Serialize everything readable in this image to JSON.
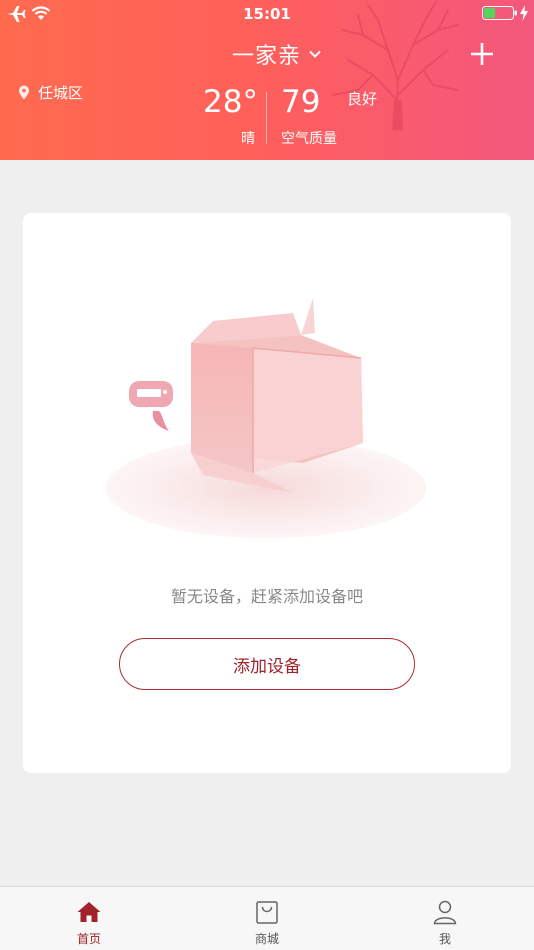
{
  "status_bar": {
    "time": "15:01",
    "battery_percent": 40
  },
  "header": {
    "family_name": "一家亲",
    "location": "任城区",
    "temperature": "28°",
    "weather": "晴",
    "aqi_value": "79",
    "aqi_level": "良好",
    "aqi_label": "空气质量"
  },
  "main": {
    "empty_message": "暂无设备，赶紧添加设备吧",
    "add_button_label": "添加设备"
  },
  "tabbar": {
    "tabs": [
      {
        "label": "首页",
        "icon": "home-icon",
        "active": true
      },
      {
        "label": "商城",
        "icon": "shopping-bag-icon",
        "active": false
      },
      {
        "label": "我",
        "icon": "user-icon",
        "active": false
      }
    ]
  },
  "colors": {
    "header_gradient_start": "#ff6a4f",
    "header_gradient_end": "#f2587c",
    "accent": "#a0222b",
    "background": "#efefef"
  }
}
